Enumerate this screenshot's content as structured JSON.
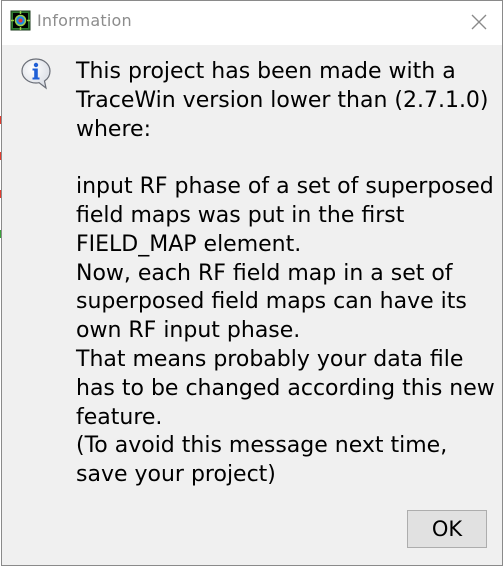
{
  "window": {
    "title": "Information",
    "app_icon": "tracewin-app-icon",
    "close_icon": "close-icon"
  },
  "message": {
    "icon": "info-icon",
    "paragraph1": [
      "This project has been made with a",
      "TraceWin version lower than (2.7.1.0)",
      "where:"
    ],
    "paragraph2": [
      "input RF phase of a set of superposed",
      "field maps was put in the first",
      "FIELD_MAP element.",
      "Now, each RF field map in a set of",
      "superposed field maps can have its",
      "own RF input phase.",
      "That means probably your data file",
      "has to be changed according this new",
      "feature.",
      "(To avoid this message next time,",
      "save your project)"
    ]
  },
  "buttons": {
    "ok_label": "OK"
  },
  "colors": {
    "dialog_bg": "#f0f0f0",
    "titlebar_bg": "#ffffff",
    "title_text": "#8c8c8c",
    "button_bg": "#e1e1e1",
    "button_border": "#adadad",
    "info_icon_blue": "#1f5fd6"
  }
}
